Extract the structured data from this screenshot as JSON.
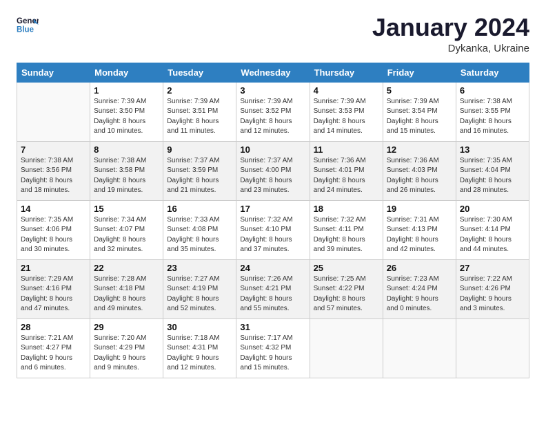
{
  "header": {
    "logo_line1": "General",
    "logo_line2": "Blue",
    "month_title": "January 2024",
    "subtitle": "Dykanka, Ukraine"
  },
  "days_of_week": [
    "Sunday",
    "Monday",
    "Tuesday",
    "Wednesday",
    "Thursday",
    "Friday",
    "Saturday"
  ],
  "weeks": [
    [
      {
        "num": "",
        "info": ""
      },
      {
        "num": "1",
        "info": "Sunrise: 7:39 AM\nSunset: 3:50 PM\nDaylight: 8 hours\nand 10 minutes."
      },
      {
        "num": "2",
        "info": "Sunrise: 7:39 AM\nSunset: 3:51 PM\nDaylight: 8 hours\nand 11 minutes."
      },
      {
        "num": "3",
        "info": "Sunrise: 7:39 AM\nSunset: 3:52 PM\nDaylight: 8 hours\nand 12 minutes."
      },
      {
        "num": "4",
        "info": "Sunrise: 7:39 AM\nSunset: 3:53 PM\nDaylight: 8 hours\nand 14 minutes."
      },
      {
        "num": "5",
        "info": "Sunrise: 7:39 AM\nSunset: 3:54 PM\nDaylight: 8 hours\nand 15 minutes."
      },
      {
        "num": "6",
        "info": "Sunrise: 7:38 AM\nSunset: 3:55 PM\nDaylight: 8 hours\nand 16 minutes."
      }
    ],
    [
      {
        "num": "7",
        "info": "Sunrise: 7:38 AM\nSunset: 3:56 PM\nDaylight: 8 hours\nand 18 minutes."
      },
      {
        "num": "8",
        "info": "Sunrise: 7:38 AM\nSunset: 3:58 PM\nDaylight: 8 hours\nand 19 minutes."
      },
      {
        "num": "9",
        "info": "Sunrise: 7:37 AM\nSunset: 3:59 PM\nDaylight: 8 hours\nand 21 minutes."
      },
      {
        "num": "10",
        "info": "Sunrise: 7:37 AM\nSunset: 4:00 PM\nDaylight: 8 hours\nand 23 minutes."
      },
      {
        "num": "11",
        "info": "Sunrise: 7:36 AM\nSunset: 4:01 PM\nDaylight: 8 hours\nand 24 minutes."
      },
      {
        "num": "12",
        "info": "Sunrise: 7:36 AM\nSunset: 4:03 PM\nDaylight: 8 hours\nand 26 minutes."
      },
      {
        "num": "13",
        "info": "Sunrise: 7:35 AM\nSunset: 4:04 PM\nDaylight: 8 hours\nand 28 minutes."
      }
    ],
    [
      {
        "num": "14",
        "info": "Sunrise: 7:35 AM\nSunset: 4:06 PM\nDaylight: 8 hours\nand 30 minutes."
      },
      {
        "num": "15",
        "info": "Sunrise: 7:34 AM\nSunset: 4:07 PM\nDaylight: 8 hours\nand 32 minutes."
      },
      {
        "num": "16",
        "info": "Sunrise: 7:33 AM\nSunset: 4:08 PM\nDaylight: 8 hours\nand 35 minutes."
      },
      {
        "num": "17",
        "info": "Sunrise: 7:32 AM\nSunset: 4:10 PM\nDaylight: 8 hours\nand 37 minutes."
      },
      {
        "num": "18",
        "info": "Sunrise: 7:32 AM\nSunset: 4:11 PM\nDaylight: 8 hours\nand 39 minutes."
      },
      {
        "num": "19",
        "info": "Sunrise: 7:31 AM\nSunset: 4:13 PM\nDaylight: 8 hours\nand 42 minutes."
      },
      {
        "num": "20",
        "info": "Sunrise: 7:30 AM\nSunset: 4:14 PM\nDaylight: 8 hours\nand 44 minutes."
      }
    ],
    [
      {
        "num": "21",
        "info": "Sunrise: 7:29 AM\nSunset: 4:16 PM\nDaylight: 8 hours\nand 47 minutes."
      },
      {
        "num": "22",
        "info": "Sunrise: 7:28 AM\nSunset: 4:18 PM\nDaylight: 8 hours\nand 49 minutes."
      },
      {
        "num": "23",
        "info": "Sunrise: 7:27 AM\nSunset: 4:19 PM\nDaylight: 8 hours\nand 52 minutes."
      },
      {
        "num": "24",
        "info": "Sunrise: 7:26 AM\nSunset: 4:21 PM\nDaylight: 8 hours\nand 55 minutes."
      },
      {
        "num": "25",
        "info": "Sunrise: 7:25 AM\nSunset: 4:22 PM\nDaylight: 8 hours\nand 57 minutes."
      },
      {
        "num": "26",
        "info": "Sunrise: 7:23 AM\nSunset: 4:24 PM\nDaylight: 9 hours\nand 0 minutes."
      },
      {
        "num": "27",
        "info": "Sunrise: 7:22 AM\nSunset: 4:26 PM\nDaylight: 9 hours\nand 3 minutes."
      }
    ],
    [
      {
        "num": "28",
        "info": "Sunrise: 7:21 AM\nSunset: 4:27 PM\nDaylight: 9 hours\nand 6 minutes."
      },
      {
        "num": "29",
        "info": "Sunrise: 7:20 AM\nSunset: 4:29 PM\nDaylight: 9 hours\nand 9 minutes."
      },
      {
        "num": "30",
        "info": "Sunrise: 7:18 AM\nSunset: 4:31 PM\nDaylight: 9 hours\nand 12 minutes."
      },
      {
        "num": "31",
        "info": "Sunrise: 7:17 AM\nSunset: 4:32 PM\nDaylight: 9 hours\nand 15 minutes."
      },
      {
        "num": "",
        "info": ""
      },
      {
        "num": "",
        "info": ""
      },
      {
        "num": "",
        "info": ""
      }
    ]
  ]
}
